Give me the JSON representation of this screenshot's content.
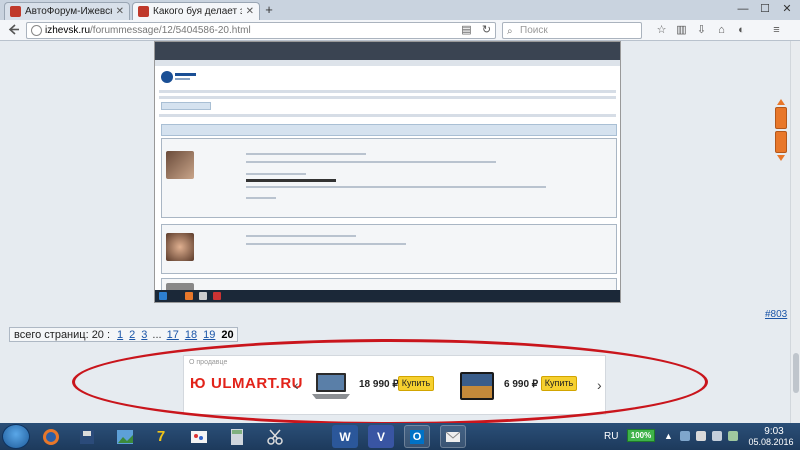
{
  "browser": {
    "tabs": [
      {
        "title": "АвтоФорум-Ижевск : Ма...",
        "active": false,
        "favicon_color": "#c0392b"
      },
      {
        "title": "Какого буя делает закрыт...",
        "active": true,
        "favicon_color": "#c0392b"
      }
    ],
    "address": {
      "host": "izhevsk.ru",
      "path": "/forummessage/12/5404586-20.html"
    },
    "search_placeholder": "Поиск",
    "window_controls": [
      "minimize",
      "maximize",
      "close"
    ]
  },
  "page": {
    "ref_link": "#803",
    "pager": {
      "label": "всего страниц: 20 :",
      "pages": [
        "1",
        "2",
        "3",
        "...",
        "17",
        "18",
        "19",
        "20"
      ],
      "current": "20"
    },
    "ad": {
      "label": "О продавце",
      "brand": "ULMART.RU",
      "items": [
        {
          "price": "18 990 ₽",
          "button": "Купить",
          "image": "laptop"
        },
        {
          "price": "6 990 ₽",
          "button": "Купить",
          "image": "tablet"
        }
      ]
    },
    "highlight_color": "#c9151c"
  },
  "taskbar": {
    "language": "RU",
    "battery": "100%",
    "time": "9:03",
    "date": "05.08.2016"
  }
}
